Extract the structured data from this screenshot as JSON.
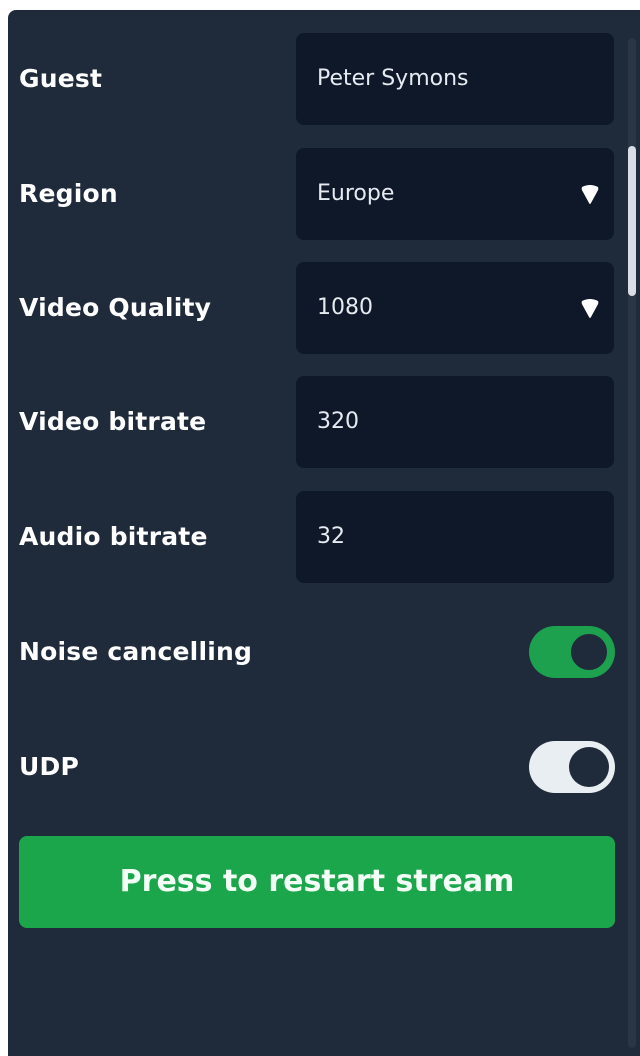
{
  "settings": {
    "guest": {
      "label": "Guest",
      "value": "Peter Symons"
    },
    "region": {
      "label": "Region",
      "value": "Europe"
    },
    "video_quality": {
      "label": "Video Quality",
      "value": "1080"
    },
    "video_bitrate": {
      "label": "Video bitrate",
      "value": "320"
    },
    "audio_bitrate": {
      "label": "Audio bitrate",
      "value": "32"
    },
    "noise_cancelling": {
      "label": "Noise cancelling",
      "enabled": true
    },
    "udp": {
      "label": "UDP",
      "enabled": false
    }
  },
  "restart_button": {
    "label": "Press to restart stream"
  },
  "colors": {
    "panel_bg": "#1f2a3a",
    "field_bg": "#0f1828",
    "accent_green": "#1ba64b",
    "toggle_off_bg": "#e9eef3",
    "text": "#ffffff"
  },
  "icons": {
    "dropdown": "caret-down-icon"
  }
}
